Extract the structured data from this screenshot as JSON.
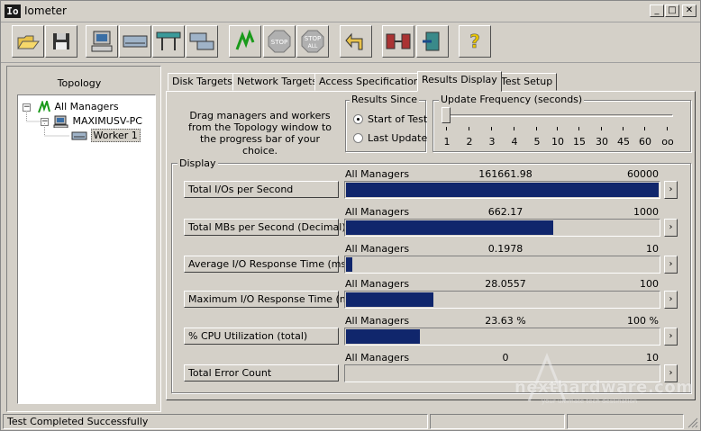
{
  "window": {
    "title": "Iometer",
    "icon_text": "Io",
    "min_glyph": "_",
    "max_glyph": "□",
    "close_glyph": "✕"
  },
  "toolbar": {
    "buttons": [
      {
        "name": "open-config-icon"
      },
      {
        "name": "save-config-icon"
      },
      {
        "name": "new-manager-icon"
      },
      {
        "name": "new-disk-worker-icon"
      },
      {
        "name": "new-network-worker-icon"
      },
      {
        "name": "duplicate-worker-icon"
      },
      {
        "name": "start-tests-icon"
      },
      {
        "name": "stop-test-icon",
        "label": "STOP"
      },
      {
        "name": "stop-all-icon",
        "label": "STOP",
        "sub": "ALL"
      },
      {
        "name": "reset-workers-icon"
      },
      {
        "name": "disconnect-icon"
      },
      {
        "name": "exit-icon"
      },
      {
        "name": "help-icon",
        "label": "?"
      }
    ]
  },
  "topology": {
    "title": "Topology",
    "items": [
      {
        "label": "All Managers",
        "expander": "−"
      },
      {
        "label": "MAXIMUSV-PC",
        "expander": "−"
      },
      {
        "label": "Worker 1"
      }
    ]
  },
  "tabs": [
    {
      "label": "Disk Targets"
    },
    {
      "label": "Network Targets"
    },
    {
      "label": "Access Specifications"
    },
    {
      "label": "Results Display",
      "active": true
    },
    {
      "label": "Test Setup"
    }
  ],
  "results": {
    "instructions": "Drag managers and workers from the Topology window to the progress bar of your choice.",
    "results_since": {
      "label": "Results Since",
      "options": [
        "Start of Test",
        "Last Update"
      ],
      "selected": "Start of Test"
    },
    "update_frequency": {
      "label": "Update Frequency (seconds)",
      "ticks": [
        "1",
        "2",
        "3",
        "4",
        "5",
        "10",
        "15",
        "30",
        "45",
        "60",
        "oo"
      ],
      "selected": "1"
    },
    "display_label": "Display",
    "arrow_glyph": "›",
    "rows": [
      {
        "metric": "Total I/Os per Second",
        "manager": "All Managers",
        "value": "161661.98",
        "max": "60000",
        "fill": 1.0
      },
      {
        "metric": "Total MBs per Second (Decimal)",
        "manager": "All Managers",
        "value": "662.17",
        "max": "1000",
        "fill": 0.66217
      },
      {
        "metric": "Average I/O Response Time (ms)",
        "manager": "All Managers",
        "value": "0.1978",
        "max": "10",
        "fill": 0.01978
      },
      {
        "metric": "Maximum I/O Response Time (ms)",
        "manager": "All Managers",
        "value": "28.0557",
        "max": "100",
        "fill": 0.280557
      },
      {
        "metric": "% CPU Utilization (total)",
        "manager": "All Managers",
        "value": "23.63 %",
        "max": "100 %",
        "fill": 0.2363
      },
      {
        "metric": "Total Error Count",
        "manager": "All Managers",
        "value": "0",
        "max": "10",
        "fill": 0
      }
    ]
  },
  "status": {
    "text": "Test Completed Successfully"
  },
  "watermark": {
    "text": "nexthardware.com",
    "sub": "your ultimate tech destination"
  }
}
